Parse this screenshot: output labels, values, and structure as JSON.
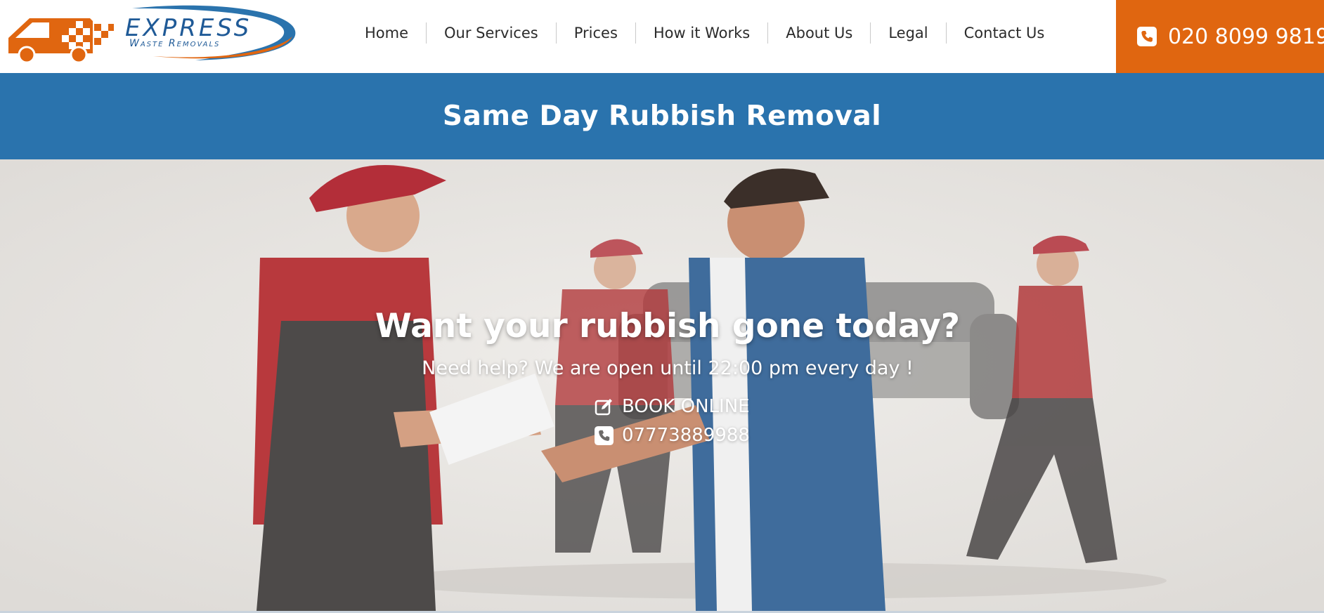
{
  "header": {
    "logo": {
      "main": "EXPRESS",
      "sub": "Waste Removals"
    },
    "nav": [
      {
        "label": "Home"
      },
      {
        "label": "Our Services"
      },
      {
        "label": "Prices"
      },
      {
        "label": "How it Works"
      },
      {
        "label": "About Us"
      },
      {
        "label": "Legal"
      },
      {
        "label": "Contact Us"
      }
    ],
    "phone": {
      "icon": "phone-icon",
      "number": "020 8099 9819"
    }
  },
  "banner": {
    "title": "Same Day Rubbish Removal"
  },
  "hero": {
    "title": "Want your rubbish gone today?",
    "subtitle": "Need help? We are open until 22:00 pm every day !",
    "book": {
      "icon": "edit-icon",
      "label": "BOOK ONLINE"
    },
    "mobile": {
      "icon": "phone-icon",
      "number": "07773889988"
    }
  },
  "colors": {
    "brand_orange": "#e06610",
    "brand_blue": "#2a73ad",
    "logo_blue": "#1f5a97",
    "nav_text": "#2b2b2b"
  }
}
